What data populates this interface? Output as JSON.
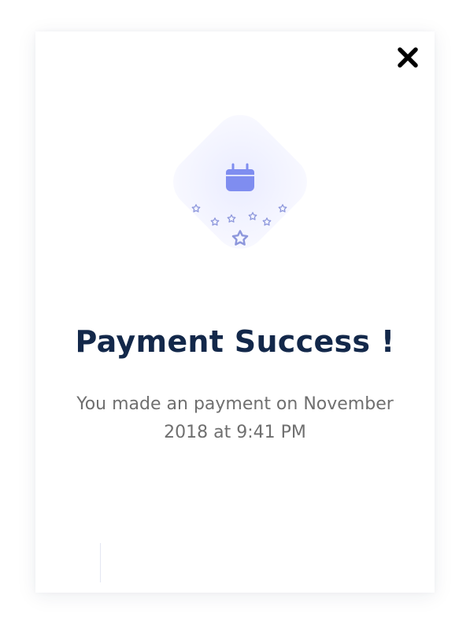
{
  "modal": {
    "title": "Payment Success !",
    "message": "You made an payment on November 2018 at 9:41 PM"
  },
  "icons": {
    "close": "close-icon",
    "calendar": "calendar-icon",
    "stars": "star-icon"
  },
  "colors": {
    "title": "#13284a",
    "message": "#6f6f6f",
    "accent": "#7f8df0",
    "star": "#8d97dc",
    "close": "#000000"
  }
}
